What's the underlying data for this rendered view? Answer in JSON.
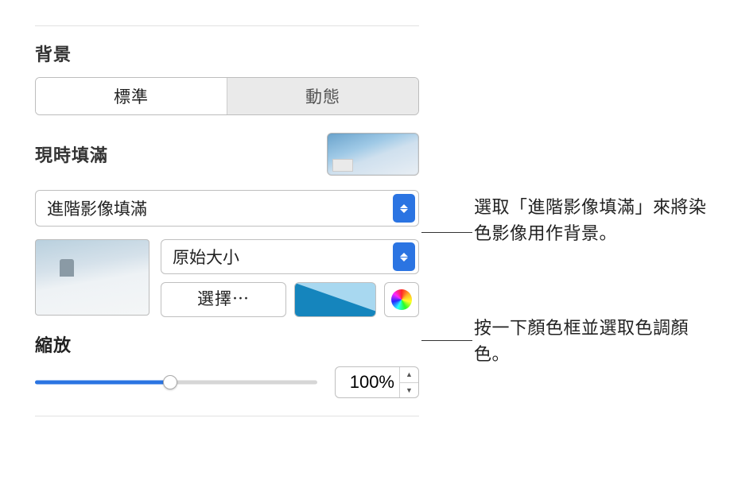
{
  "section_title": "背景",
  "tabs": {
    "standard": "標準",
    "dynamic": "動態"
  },
  "current_fill_label": "現時填滿",
  "fill_type": "進階影像填滿",
  "scale_type": "原始大小",
  "choose_label": "選擇⋯",
  "zoom": {
    "label": "縮放",
    "value": "100%"
  },
  "callouts": {
    "fill": "選取「進階影像填滿」來將染色影像用作背景。",
    "color": "按一下顏色框並選取色調顏色。"
  },
  "colors": {
    "accent": "#2b74e2",
    "tint": "#1585bd"
  }
}
